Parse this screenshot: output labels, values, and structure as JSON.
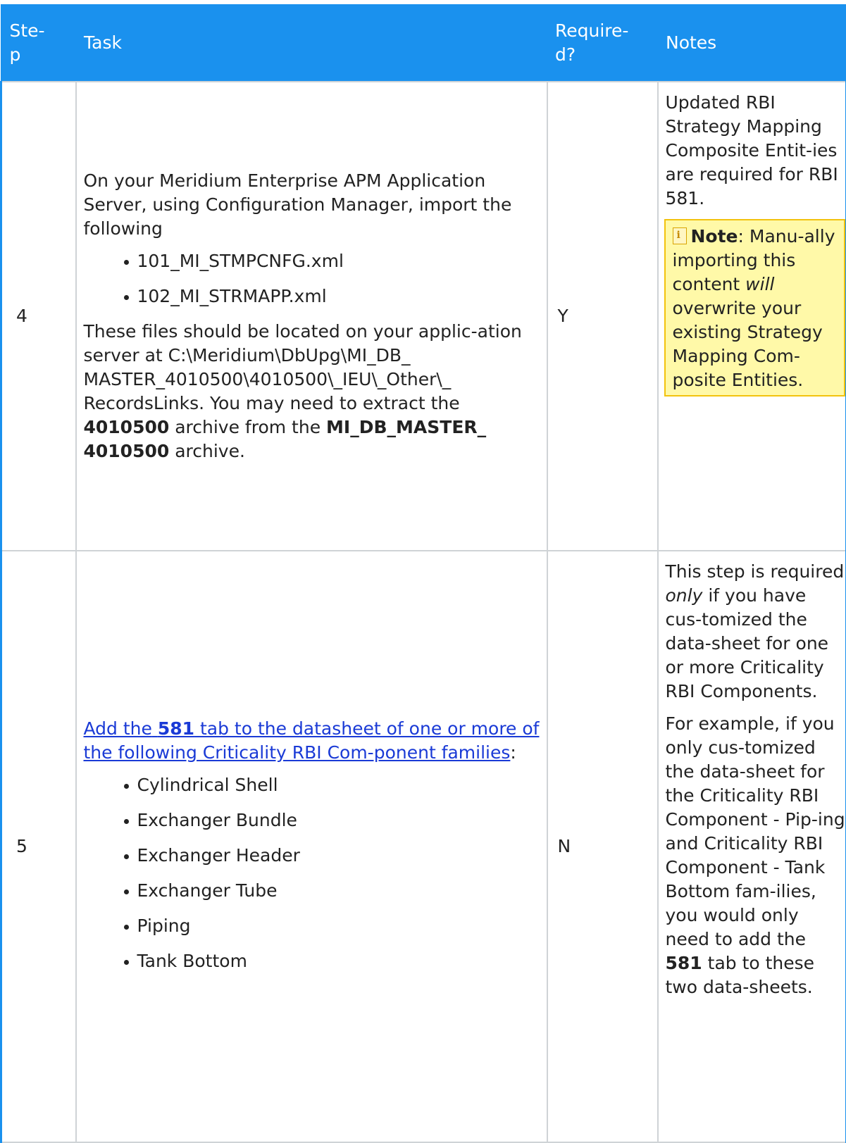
{
  "header": {
    "step": "Ste-\np",
    "task": "Task",
    "required": "Require-\nd?",
    "notes": "Notes"
  },
  "rows": [
    {
      "step": "4",
      "task_intro": "On your Meridium Enterprise APM Application Server, using Configuration Manager, import the following",
      "files": [
        "101_MI_STMPCNFG.xml",
        "102_MI_STRMAPP.xml"
      ],
      "location_text": "These files should be located on your applic-ation server at C:\\Meridium\\DbUpg\\MI_DB_ MASTER_4010500\\4010500\\_IEU\\_Other\\_ RecordsLinks. You may need to extract the",
      "archive_1": "4010500",
      "archive_mid": "archive from the",
      "archive_2": "MI_DB_MASTER_ 4010500",
      "archive_end": "archive.",
      "required": "Y",
      "notes_text": "Updated RBI Strategy Mapping Composite Entit-ies are required for RBI 581.",
      "note_label": "Note",
      "note_pre": ": Manu-ally importing this content",
      "note_em": "will",
      "note_post": "overwrite your existing Strategy Mapping Com-posite Entities."
    },
    {
      "step": "5",
      "link_pre": "Add the",
      "link_bold": "581",
      "link_post": "tab to the datasheet of one or more of the following Criticality RBI Com-ponent families",
      "link_colon": ":",
      "families": [
        "Cylindrical Shell",
        "Exchanger Bundle",
        "Exchanger Header",
        "Exchanger Tube",
        "Piping",
        "Tank Bottom"
      ],
      "required": "N",
      "notes_1_pre": "This step is required",
      "notes_1_em": "only",
      "notes_1_post": "if you have cus-tomized the data-sheet for one or more Criticality RBI Components.",
      "notes_2_pre": "For example, if you only cus-tomized the data-sheet for the Criticality RBI Component - Pip-ing and Criticality RBI Component - Tank Bottom fam-ilies, you would only need to add the",
      "notes_2_bold": "581",
      "notes_2_post": "tab to these two data-sheets."
    }
  ]
}
